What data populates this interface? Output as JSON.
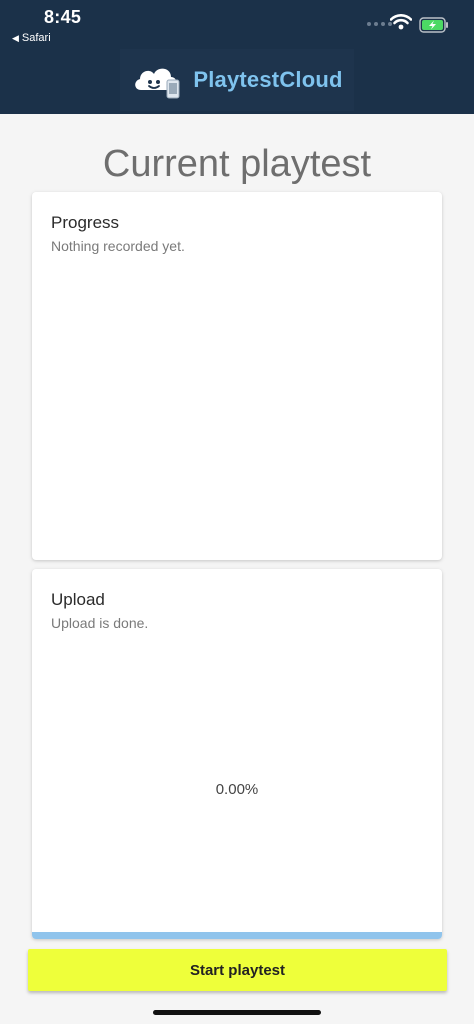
{
  "status_bar": {
    "time": "8:45",
    "back_app": "Safari",
    "icons": [
      "signal-icon",
      "wifi-icon",
      "battery-charging-icon"
    ]
  },
  "header": {
    "logo_text": "PlaytestCloud",
    "logo_icon": "cloud-mascot-icon"
  },
  "page": {
    "title": "Current playtest"
  },
  "progress_card": {
    "title": "Progress",
    "status": "Nothing recorded yet."
  },
  "upload_card": {
    "title": "Upload",
    "status": "Upload is done.",
    "percent_label": "0.00%",
    "progress_fraction": 1.0
  },
  "actions": {
    "start_label": "Start playtest"
  },
  "colors": {
    "header_bg": "#1b3149",
    "logo_text": "#7fc3ee",
    "button_bg": "#eeff3a",
    "progress_fill": "#90c4ec",
    "battery": "#4cd964"
  }
}
